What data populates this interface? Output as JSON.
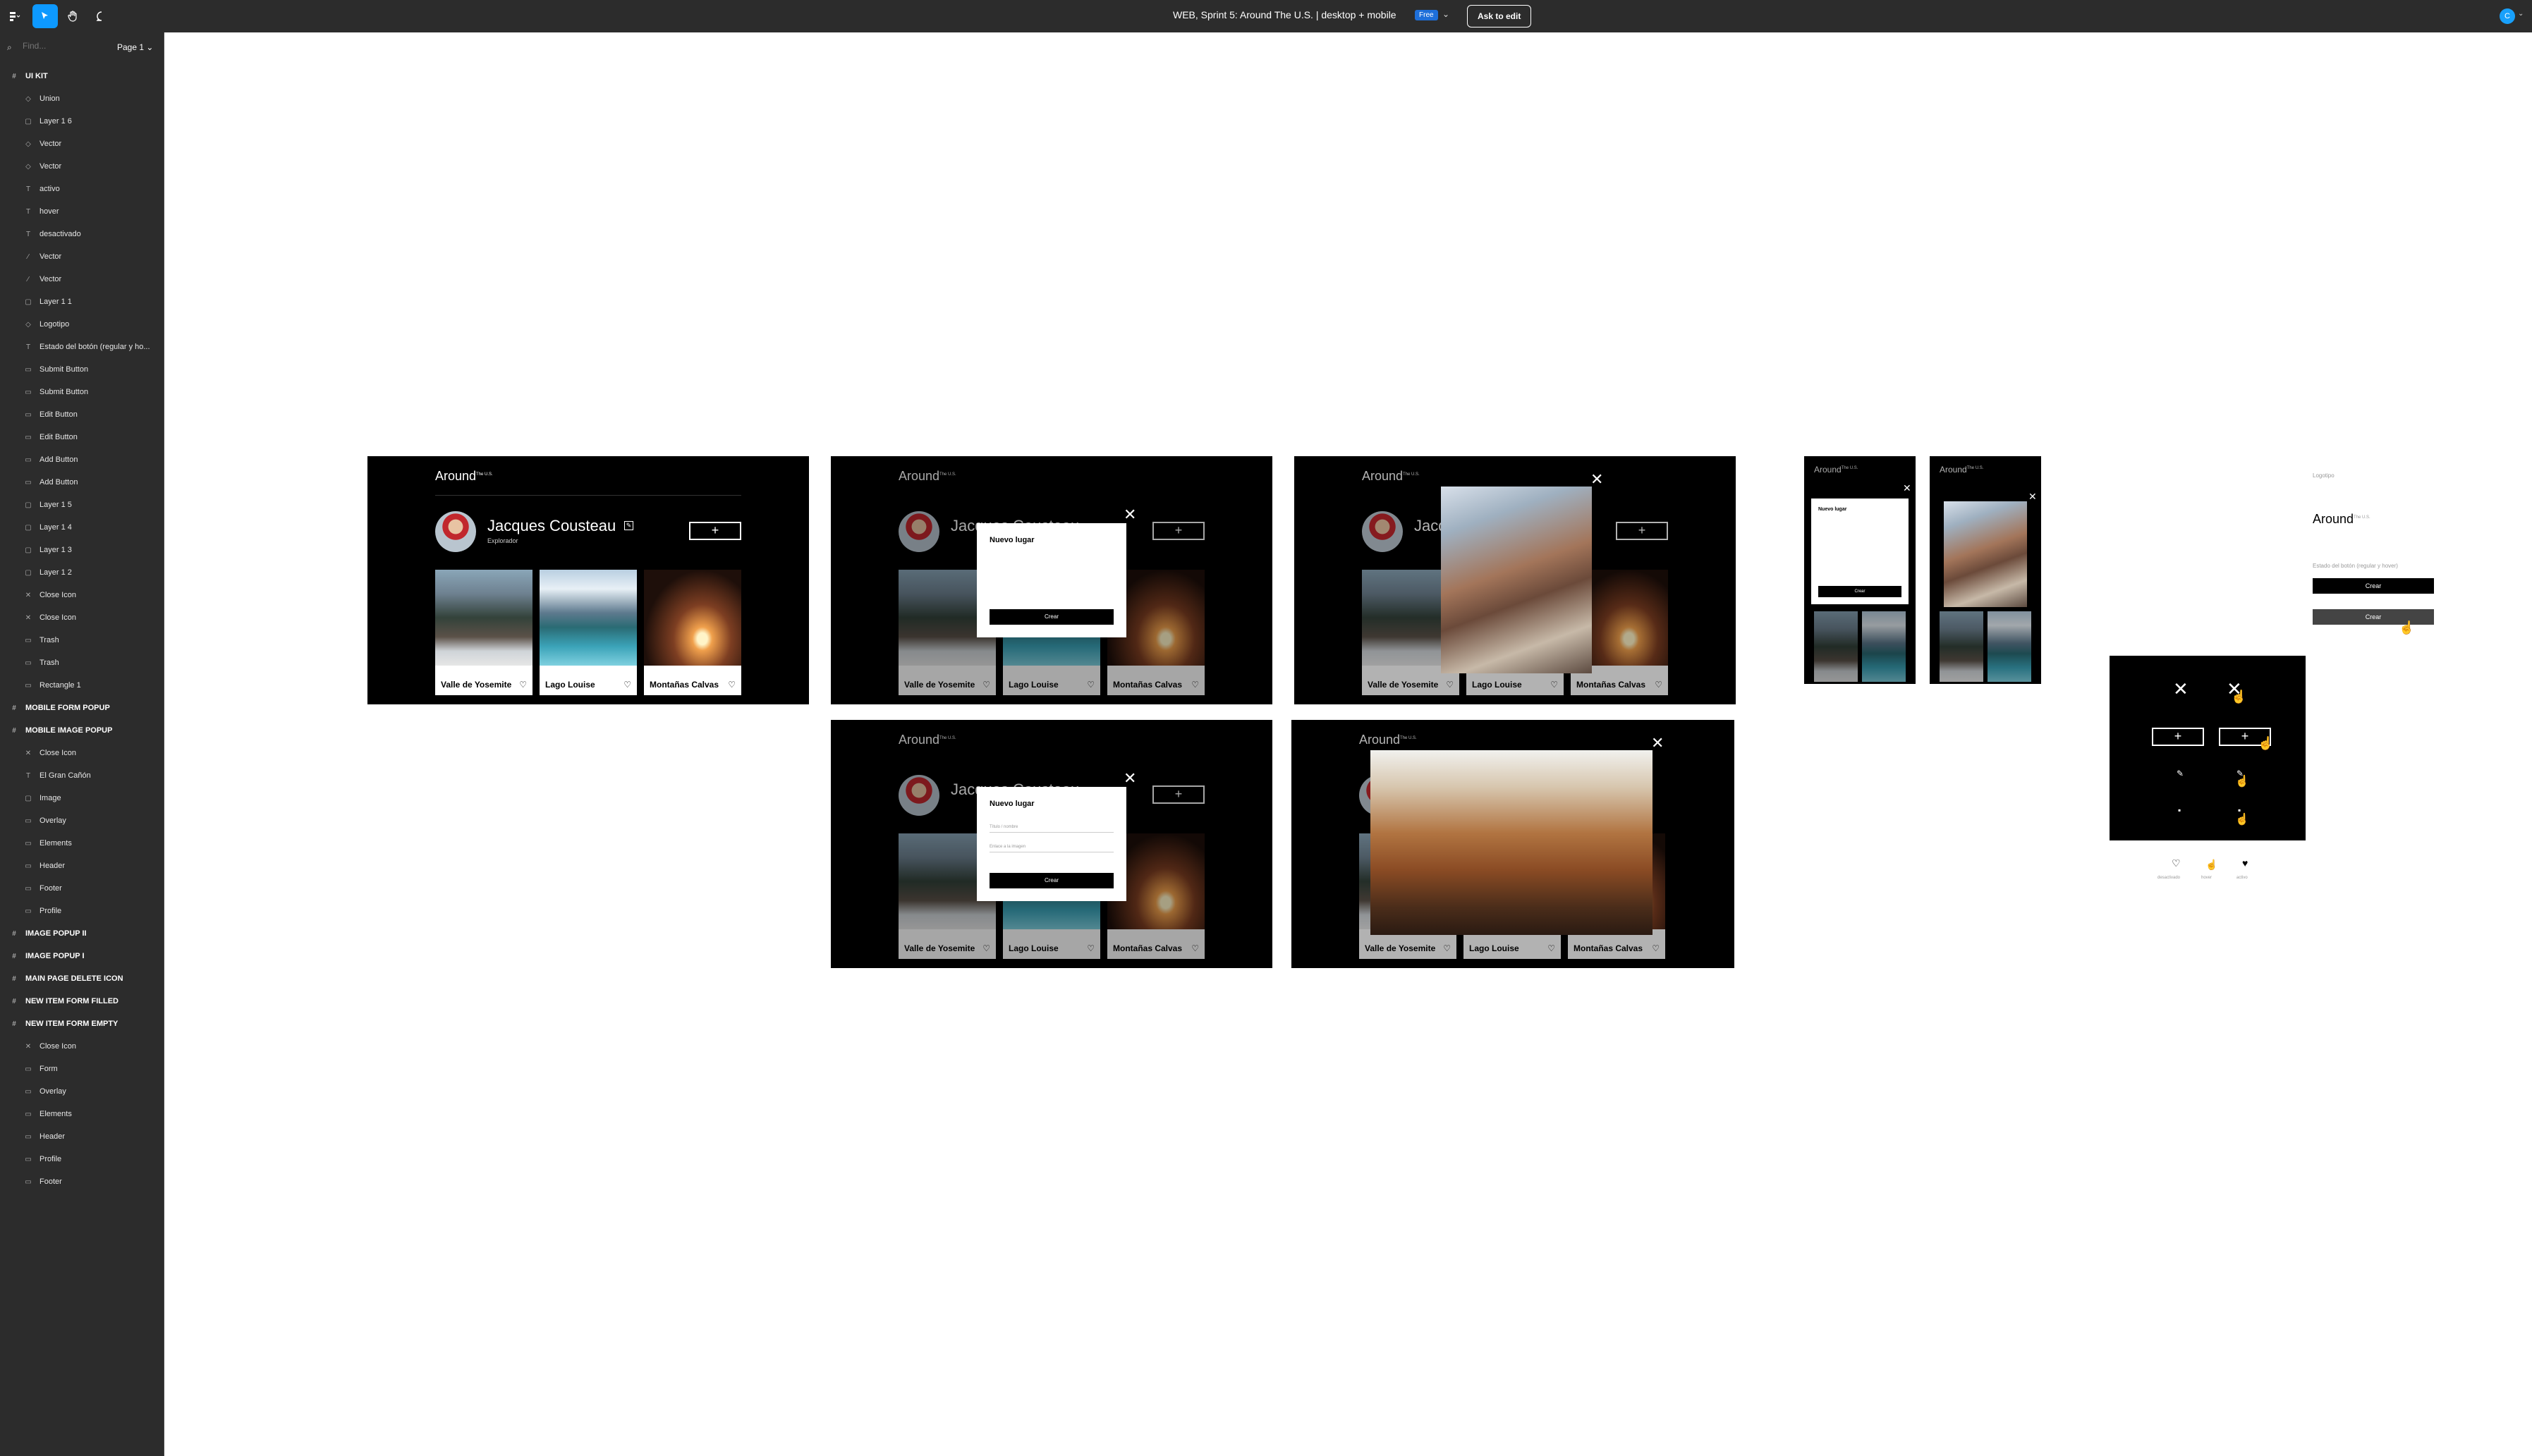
{
  "topbar": {
    "title": "WEB, Sprint 5: Around The U.S. | desktop + mobile",
    "badge": "Free",
    "ask_to_edit": "Ask to edit",
    "user_initial": "C"
  },
  "sidebar": {
    "find_placeholder": "Find...",
    "page": "Page 1",
    "layers": [
      {
        "label": "UI KIT",
        "level": "top",
        "icon": "#"
      },
      {
        "label": "Union",
        "level": "child",
        "icon": "◇"
      },
      {
        "label": "Layer 1 6",
        "level": "child",
        "icon": "▢"
      },
      {
        "label": "Vector",
        "level": "child",
        "icon": "◇"
      },
      {
        "label": "Vector",
        "level": "child",
        "icon": "◇"
      },
      {
        "label": "activo",
        "level": "child",
        "icon": "T"
      },
      {
        "label": "hover",
        "level": "child",
        "icon": "T"
      },
      {
        "label": "desactivado",
        "level": "child",
        "icon": "T"
      },
      {
        "label": "Vector",
        "level": "child",
        "icon": "∕"
      },
      {
        "label": "Vector",
        "level": "child",
        "icon": "∕"
      },
      {
        "label": "Layer 1 1",
        "level": "child",
        "icon": "▢"
      },
      {
        "label": "Logotipo",
        "level": "child",
        "icon": "◇"
      },
      {
        "label": "Estado del botón (regular y ho...",
        "level": "child",
        "icon": "T"
      },
      {
        "label": "Submit Button",
        "level": "child",
        "icon": "▭"
      },
      {
        "label": "Submit Button",
        "level": "child",
        "icon": "▭"
      },
      {
        "label": "Edit Button",
        "level": "child",
        "icon": "▭"
      },
      {
        "label": "Edit Button",
        "level": "child",
        "icon": "▭"
      },
      {
        "label": "Add Button",
        "level": "child",
        "icon": "▭"
      },
      {
        "label": "Add Button",
        "level": "child",
        "icon": "▭"
      },
      {
        "label": "Layer 1 5",
        "level": "child",
        "icon": "▢"
      },
      {
        "label": "Layer 1 4",
        "level": "child",
        "icon": "▢"
      },
      {
        "label": "Layer 1 3",
        "level": "child",
        "icon": "▢"
      },
      {
        "label": "Layer 1 2",
        "level": "child",
        "icon": "▢"
      },
      {
        "label": "Close Icon",
        "level": "child",
        "icon": "✕"
      },
      {
        "label": "Close Icon",
        "level": "child",
        "icon": "✕"
      },
      {
        "label": "Trash",
        "level": "child",
        "icon": "▭"
      },
      {
        "label": "Trash",
        "level": "child",
        "icon": "▭"
      },
      {
        "label": "Rectangle 1",
        "level": "child",
        "icon": "▭"
      },
      {
        "label": "MOBILE FORM POPUP",
        "level": "top",
        "icon": "#"
      },
      {
        "label": "MOBILE IMAGE POPUP",
        "level": "top",
        "icon": "#"
      },
      {
        "label": "Close Icon",
        "level": "child",
        "icon": "✕"
      },
      {
        "label": "El Gran Cañón",
        "level": "child",
        "icon": "T"
      },
      {
        "label": "Image",
        "level": "child",
        "icon": "▢"
      },
      {
        "label": "Overlay",
        "level": "child",
        "icon": "▭"
      },
      {
        "label": "Elements",
        "level": "child",
        "icon": "▭"
      },
      {
        "label": "Header",
        "level": "child",
        "icon": "▭"
      },
      {
        "label": "Footer",
        "level": "child",
        "icon": "▭"
      },
      {
        "label": "Profile",
        "level": "child",
        "icon": "▭"
      },
      {
        "label": "IMAGE POPUP II",
        "level": "top",
        "icon": "#"
      },
      {
        "label": "IMAGE POPUP I",
        "level": "top",
        "icon": "#"
      },
      {
        "label": "MAIN PAGE DELETE ICON",
        "level": "top",
        "icon": "#"
      },
      {
        "label": "NEW ITEM FORM FILLED",
        "level": "top",
        "icon": "#"
      },
      {
        "label": "NEW ITEM FORM EMPTY",
        "level": "top",
        "icon": "#"
      },
      {
        "label": "Close Icon",
        "level": "child",
        "icon": "✕"
      },
      {
        "label": "Form",
        "level": "child",
        "icon": "▭"
      },
      {
        "label": "Overlay",
        "level": "child",
        "icon": "▭"
      },
      {
        "label": "Elements",
        "level": "child",
        "icon": "▭"
      },
      {
        "label": "Header",
        "level": "child",
        "icon": "▭"
      },
      {
        "label": "Profile",
        "level": "child",
        "icon": "▭"
      },
      {
        "label": "Footer",
        "level": "child",
        "icon": "▭"
      }
    ]
  },
  "app": {
    "logo": "Around",
    "logo_sup": "The U.S.",
    "profile_name": "Jacques Cousteau",
    "profile_sub": "Explorador",
    "add_symbol": "+",
    "edit_symbol": "✎",
    "close_symbol": "✕",
    "cards": [
      {
        "title": "Valle de Yosemite"
      },
      {
        "title": "Lago Louise"
      },
      {
        "title": "Montañas Calvas"
      }
    ],
    "heart": "♡",
    "popup_title": "Nuevo lugar",
    "popup_button": "Crear",
    "popup_field1": "Título / nombre",
    "popup_field2": "Enlace a la imagen"
  },
  "uikit": {
    "logo_label": "Logotipo",
    "button_state_label": "Estado del botón (regular y hover)",
    "crear": "Crear",
    "icon_labels": [
      "desactivado",
      "hover",
      "activo"
    ]
  }
}
